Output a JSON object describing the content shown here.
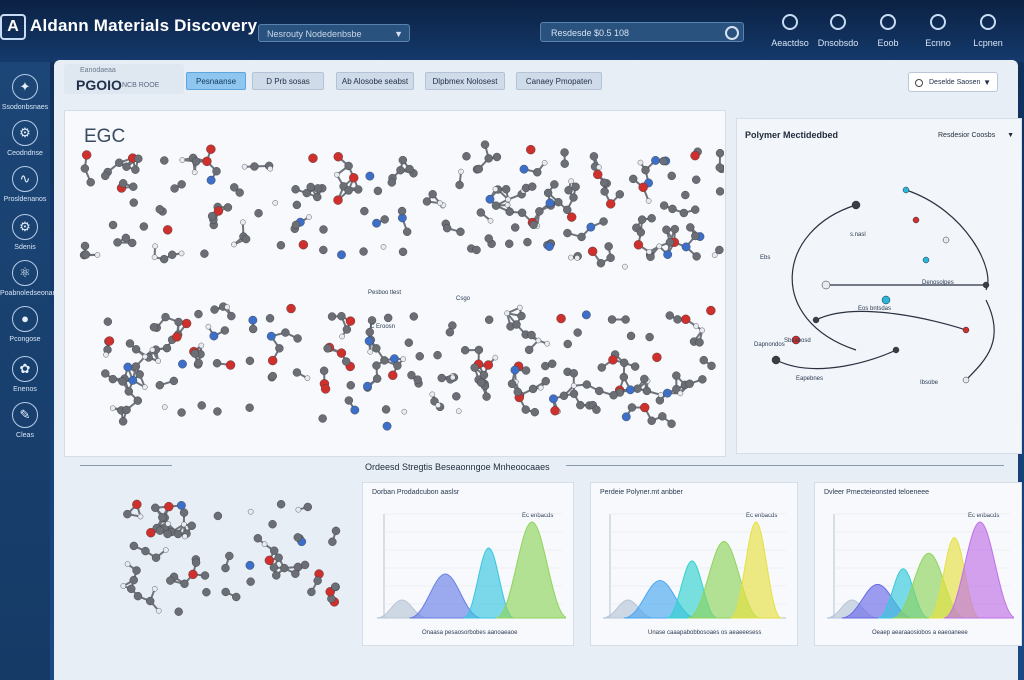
{
  "app": {
    "title": "Aldann Materials Discovery",
    "logo_letter": "A"
  },
  "topbar": {
    "project_select": "Nesrouty Nodedenbsbe",
    "search_value": "Resdesde  $0.5 108",
    "nav": [
      {
        "label": "Aeactdso",
        "icon": "gear-icon"
      },
      {
        "label": "Dnsobsdo",
        "icon": "settings-icon"
      },
      {
        "label": "Eoob",
        "icon": "gear-icon"
      },
      {
        "label": "Ecnno",
        "icon": "recycle-icon"
      },
      {
        "label": "Lcpnen",
        "icon": "gear-icon"
      }
    ]
  },
  "sidebar": {
    "items": [
      {
        "label": "Ssodonbsnaes",
        "icon": "molecule-icon"
      },
      {
        "label": "Ceodndnse",
        "icon": "flask-icon"
      },
      {
        "label": "Prosldenanos",
        "icon": "dna-icon"
      },
      {
        "label": "Sdenis",
        "icon": "gear-icon"
      },
      {
        "label": "Poabnoledseonanas",
        "icon": "atom-icon"
      },
      {
        "label": "Pcongose",
        "icon": "cluster-icon"
      },
      {
        "label": "Enenos",
        "icon": "brain-icon"
      },
      {
        "label": "Cleas",
        "icon": "pen-icon"
      }
    ]
  },
  "workspace": {
    "subtitle": "Eanodaeaa",
    "title": "PGOIO",
    "title_suffix": "NCB  ROOE",
    "tabs": [
      {
        "label": "Pesnaanse",
        "active": true
      },
      {
        "label": "D Prb sosas",
        "active": false
      },
      {
        "label": "Ab Alosobe seabst",
        "active": false
      },
      {
        "label": "Dlpbmex Nolosest",
        "active": false
      },
      {
        "label": "Canaey Pmopaten",
        "active": false
      }
    ],
    "filter_label": "Deselde Saosen"
  },
  "structure_view": {
    "label": "EGC",
    "annotations": [
      "Pesboo tlest",
      "Csgo",
      "C Eroosn"
    ]
  },
  "polymer_panel": {
    "title": "Polymer Mectidedbed",
    "select_label": "Resdesior Coosbs",
    "labels": [
      "s.nasl",
      "Ebs",
      "Denosolpes",
      "Eos bntsdas",
      "Sbsabosd",
      "Dapnondos",
      "Eapebnes",
      "Ibsobe"
    ]
  },
  "bottom": {
    "section_title": "Ordeesd Stregtis Beseaonngoe Mnheoocaaes",
    "charts": [
      {
        "title": "Dorban Prodadcubon aaslsr",
        "legend": "Ec enbacds",
        "xlabel": "Onaasa pesaosorbobes aanoaeaoe",
        "series_colors": [
          "#b9c6d8",
          "#6a7fe6",
          "#39c6e0",
          "#8fd45a"
        ]
      },
      {
        "title": "Perdeie Polyner.mt anbber",
        "legend": "Ec enbacds",
        "xlabel": "Unase caaapabobbosoaes os aeaeeesess",
        "series_colors": [
          "#b9c6d8",
          "#4aa8f0",
          "#32d2d0",
          "#8fd45a",
          "#e6e040"
        ]
      },
      {
        "title": "Dvleer Pmecteieonsted teloeneee",
        "legend": "Ec enbacds",
        "xlabel": "Oeaep aearaaosiobos a  eaeoaneee",
        "series_colors": [
          "#b9c6d8",
          "#6a6ae8",
          "#35c9dc",
          "#8fd45a",
          "#e6e040",
          "#c070e6"
        ]
      }
    ]
  }
}
